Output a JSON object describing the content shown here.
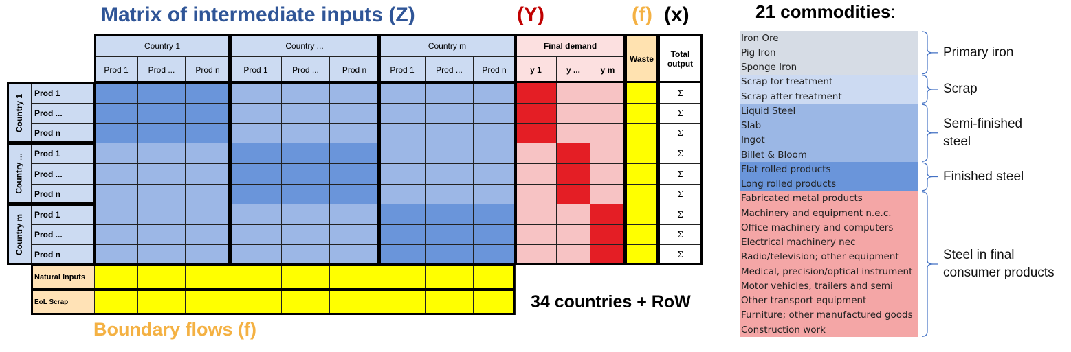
{
  "titles": {
    "z": "Matrix of intermediate inputs (Z)",
    "y": "(Y)",
    "f": "(f)",
    "x": "(x)",
    "boundary": "Boundary flows (f)",
    "countries": "34 countries + RoW",
    "commodities": "21 commodities",
    "commodities_colon": ":"
  },
  "colors": {
    "z_title": "#2F5597",
    "y_title": "#C00000",
    "f_title": "#F4B143",
    "dark_blue": "#6A95DA",
    "light_blue": "#9CB7E6",
    "header_blue": "#CCDBF2",
    "red": "#E41E25",
    "pink": "#F7C3C4",
    "yellow": "#FFFF00"
  },
  "table": {
    "countries": [
      "Country 1",
      "Country ...",
      "Country m"
    ],
    "products": [
      "Prod 1",
      "Prod ...",
      "Prod n"
    ],
    "final_demand": "Final demand",
    "y_cols": [
      "y 1",
      "y ...",
      "y m"
    ],
    "waste": "Waste",
    "total_output": "Total output",
    "sigma": "Σ",
    "boundary_rows": [
      "Natural Inputs",
      "EoL Scrap"
    ]
  },
  "commodity_groups": [
    {
      "label": "Primary iron",
      "color": "#D6DCE5",
      "items": [
        "Iron Ore",
        "Pig Iron",
        "Sponge Iron"
      ]
    },
    {
      "label": "Scrap",
      "color": "#CCDAF2",
      "items": [
        "Scrap for treatment",
        "Scrap after treatment"
      ]
    },
    {
      "label": "Semi-finished steel",
      "color": "#9BB7E5",
      "items": [
        "Liquid Steel",
        "Slab",
        "Ingot",
        "Billet & Bloom"
      ]
    },
    {
      "label": "Finished steel",
      "color": "#6A95DA",
      "items": [
        "Flat rolled products",
        "Long rolled products"
      ]
    },
    {
      "label": "Steel in final consumer products",
      "color": "#F4A6A6",
      "items": [
        "Fabricated metal products",
        "Machinery and equipment n.e.c.",
        "Office machinery and computers",
        "Electrical machinery nec",
        "Radio/television; other equipment",
        "Medical, precision/optical instrument",
        "Motor vehicles, trailers and semi",
        "Other transport equipment",
        "Furniture; other manufactured goods",
        "Construction work"
      ]
    }
  ]
}
